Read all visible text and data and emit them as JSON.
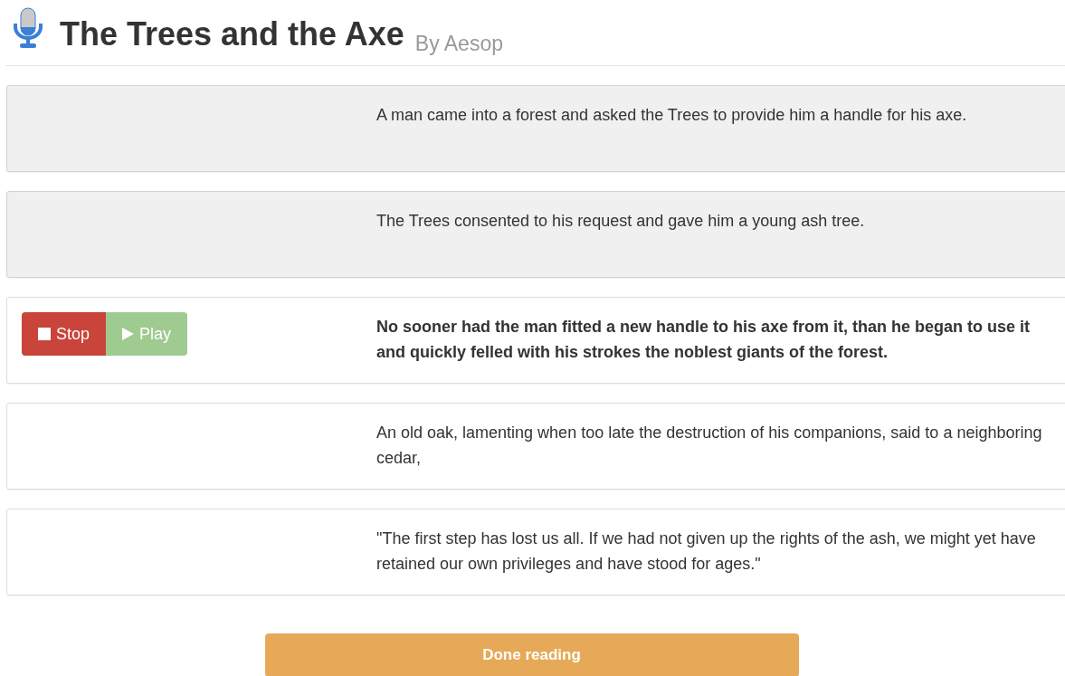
{
  "header": {
    "title": "The Trees and the Axe",
    "author": "By Aesop"
  },
  "sentences": [
    {
      "text": "A man came into a forest and asked the Trees to provide him a handle for his axe.",
      "read": true,
      "current": false
    },
    {
      "text": "The Trees consented to his request and gave him a young ash tree.",
      "read": true,
      "current": false
    },
    {
      "text": "No sooner had the man fitted a new handle to his axe from it, than he began to use it and quickly felled with his strokes the noblest giants of the forest.",
      "read": false,
      "current": true
    },
    {
      "text": "An old oak, lamenting when too late the destruction of his companions, said to a neighboring cedar,",
      "read": false,
      "current": false
    },
    {
      "text": "\"The first step has lost us all. If we had not given up the rights of the ash, we might yet have retained our own privileges and have stood for ages.\"",
      "read": false,
      "current": false
    }
  ],
  "controls": {
    "stop": {
      "label": "Stop"
    },
    "play": {
      "label": "Play",
      "disabled": true
    }
  },
  "done_button": "Done reading"
}
